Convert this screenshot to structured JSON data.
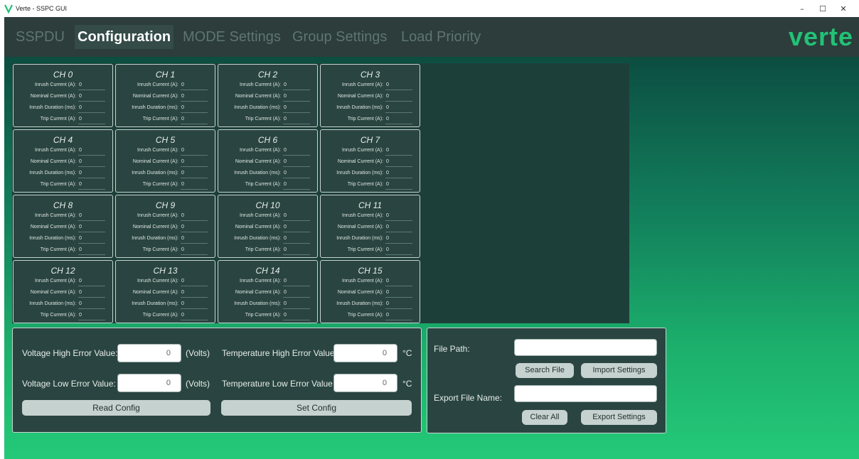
{
  "window": {
    "title": "Verte - SSPC GUI",
    "minimize": "–",
    "maximize": "☐",
    "close": "✕"
  },
  "nav": {
    "tabs": [
      "SSPDU",
      "Configuration",
      "MODE Settings",
      "Group Settings",
      "Load Priority"
    ],
    "active_tab": "Configuration",
    "brand": "verte"
  },
  "channels": [
    {
      "name": "CH 0",
      "inrush_current": "0",
      "nominal_current": "0",
      "inrush_duration": "0",
      "trip_current": "0"
    },
    {
      "name": "CH 1",
      "inrush_current": "0",
      "nominal_current": "0",
      "inrush_duration": "0",
      "trip_current": "0"
    },
    {
      "name": "CH 2",
      "inrush_current": "0",
      "nominal_current": "0",
      "inrush_duration": "0",
      "trip_current": "0"
    },
    {
      "name": "CH 3",
      "inrush_current": "0",
      "nominal_current": "0",
      "inrush_duration": "0",
      "trip_current": "0"
    },
    {
      "name": "CH 4",
      "inrush_current": "0",
      "nominal_current": "0",
      "inrush_duration": "0",
      "trip_current": "0"
    },
    {
      "name": "CH 5",
      "inrush_current": "0",
      "nominal_current": "0",
      "inrush_duration": "0",
      "trip_current": "0"
    },
    {
      "name": "CH 6",
      "inrush_current": "0",
      "nominal_current": "0",
      "inrush_duration": "0",
      "trip_current": "0"
    },
    {
      "name": "CH 7",
      "inrush_current": "0",
      "nominal_current": "0",
      "inrush_duration": "0",
      "trip_current": "0"
    },
    {
      "name": "CH 8",
      "inrush_current": "0",
      "nominal_current": "0",
      "inrush_duration": "0",
      "trip_current": "0"
    },
    {
      "name": "CH 9",
      "inrush_current": "0",
      "nominal_current": "0",
      "inrush_duration": "0",
      "trip_current": "0"
    },
    {
      "name": "CH 10",
      "inrush_current": "0",
      "nominal_current": "0",
      "inrush_duration": "0",
      "trip_current": "0"
    },
    {
      "name": "CH 11",
      "inrush_current": "0",
      "nominal_current": "0",
      "inrush_duration": "0",
      "trip_current": "0"
    },
    {
      "name": "CH 12",
      "inrush_current": "0",
      "nominal_current": "0",
      "inrush_duration": "0",
      "trip_current": "0"
    },
    {
      "name": "CH 13",
      "inrush_current": "0",
      "nominal_current": "0",
      "inrush_duration": "0",
      "trip_current": "0"
    },
    {
      "name": "CH 14",
      "inrush_current": "0",
      "nominal_current": "0",
      "inrush_duration": "0",
      "trip_current": "0"
    },
    {
      "name": "CH 15",
      "inrush_current": "0",
      "nominal_current": "0",
      "inrush_duration": "0",
      "trip_current": "0"
    }
  ],
  "channel_labels": {
    "inrush_current": "Inrush Current (A):",
    "nominal_current": "Nominal Current (A):",
    "inrush_duration": "Inrush Duration (ms):",
    "trip_current": "Trip Current (A):"
  },
  "config": {
    "voltage_high_label": "Voltage High Error Value:",
    "voltage_high_value": "0",
    "voltage_low_label": "Voltage Low Error Value:",
    "voltage_low_value": "0",
    "volts_unit": "(Volts)",
    "temp_high_label": "Temperature High Error Value:",
    "temp_high_value": "0",
    "temp_low_label": "Temperature Low Error Value:",
    "temp_low_value": "0",
    "temp_unit": "°C",
    "read_config": "Read Config",
    "set_config": "Set Config"
  },
  "file": {
    "file_path_label": "File Path:",
    "file_path_value": "",
    "search_file": "Search File",
    "import_settings": "Import Settings",
    "export_name_label": "Export File Name:",
    "export_name_value": "",
    "clear_all": "Clear All",
    "export_settings": "Export Settings"
  },
  "colors": {
    "accent": "#22c277",
    "nav_bg": "#2c3d3b",
    "panel_bg": "#2a4541",
    "button_bg": "#c6d2cf"
  }
}
